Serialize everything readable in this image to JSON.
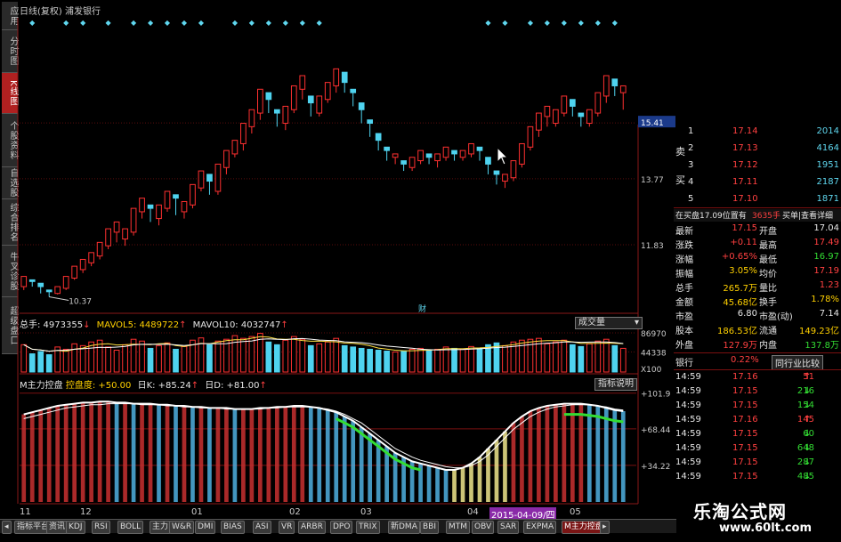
{
  "left_tabs": [
    {
      "label": "应用",
      "active": false
    },
    {
      "label": "分时图",
      "active": false
    },
    {
      "label": "K线图",
      "active": true
    },
    {
      "label": "个股资料",
      "active": false
    },
    {
      "label": "自选股",
      "active": false
    },
    {
      "label": "综合排名",
      "active": false
    },
    {
      "label": "牛叉诊股",
      "active": false
    },
    {
      "label": "超级盘口",
      "active": false
    }
  ],
  "main_chart": {
    "title": "日线(复权)  浦发银行",
    "y_ticks": [
      "15.41",
      "13.77",
      "11.83"
    ],
    "current_price_tag": "15.41",
    "low_label": "10.37",
    "finance_mark": "财"
  },
  "volume_panel": {
    "total_label": "总手: 4973355",
    "mavol5_label": "MAVOL5: 4489722",
    "mavol10_label": "MAVOL10: 4032747",
    "dropdown_label": "成交量",
    "y_ticks": [
      "86970",
      "44338",
      "X100"
    ]
  },
  "indicator_panel": {
    "name": "M主力控盘",
    "sub": "控盘度: +50.00",
    "k_label": "日K: +85.24",
    "d_label": "日D: +81.00",
    "help_button": "指标说明",
    "y_ticks": [
      "+101.9",
      "+68.44",
      "+34.22"
    ]
  },
  "x_axis": {
    "labels": [
      "11",
      "12",
      "01",
      "02",
      "03",
      "04",
      "05"
    ],
    "highlight_date": "2015-04-09/四"
  },
  "chart_data": {
    "type": "candlestick",
    "symbol": "浦发银行",
    "ylim": [
      10.0,
      18.5
    ],
    "candles": [
      [
        10.6,
        10.9,
        10.5,
        10.8
      ],
      [
        10.8,
        10.75,
        10.6,
        10.7
      ],
      [
        10.7,
        10.6,
        10.4,
        10.5
      ],
      [
        10.5,
        10.45,
        10.3,
        10.37
      ],
      [
        10.4,
        10.6,
        10.37,
        10.55
      ],
      [
        10.55,
        10.9,
        10.5,
        10.85
      ],
      [
        10.85,
        11.2,
        10.8,
        11.1
      ],
      [
        11.1,
        11.4,
        11.0,
        11.3
      ],
      [
        11.3,
        11.6,
        11.2,
        11.5
      ],
      [
        11.5,
        11.9,
        11.4,
        11.8
      ],
      [
        11.8,
        12.3,
        11.7,
        12.2
      ],
      [
        12.2,
        12.5,
        11.9,
        12.0
      ],
      [
        12.0,
        12.3,
        11.8,
        12.2
      ],
      [
        12.2,
        12.9,
        12.1,
        12.8
      ],
      [
        12.8,
        13.2,
        12.6,
        13.0
      ],
      [
        13.0,
        12.9,
        12.5,
        12.6
      ],
      [
        12.6,
        13.0,
        12.4,
        12.9
      ],
      [
        12.9,
        13.4,
        12.8,
        13.3
      ],
      [
        13.3,
        13.2,
        12.7,
        12.8
      ],
      [
        12.8,
        13.1,
        12.6,
        13.0
      ],
      [
        13.0,
        13.6,
        12.9,
        13.5
      ],
      [
        13.5,
        14.0,
        13.4,
        13.9
      ],
      [
        13.9,
        13.7,
        13.3,
        13.4
      ],
      [
        13.4,
        14.2,
        13.3,
        14.1
      ],
      [
        14.1,
        14.6,
        13.9,
        14.5
      ],
      [
        14.5,
        14.9,
        14.4,
        14.8
      ],
      [
        14.8,
        15.4,
        14.6,
        15.3
      ],
      [
        15.3,
        15.8,
        15.1,
        15.7
      ],
      [
        15.7,
        16.4,
        15.5,
        16.3
      ],
      [
        16.3,
        16.1,
        15.7,
        15.8
      ],
      [
        15.8,
        15.7,
        15.3,
        15.4
      ],
      [
        15.4,
        15.9,
        15.2,
        15.8
      ],
      [
        15.8,
        16.5,
        15.7,
        16.4
      ],
      [
        16.4,
        16.8,
        16.1,
        16.2
      ],
      [
        16.2,
        16.0,
        15.6,
        15.7
      ],
      [
        15.7,
        16.2,
        15.6,
        16.1
      ],
      [
        16.1,
        16.6,
        16.0,
        16.5
      ],
      [
        16.5,
        17.0,
        16.3,
        16.9
      ],
      [
        16.9,
        16.6,
        16.3,
        16.4
      ],
      [
        16.4,
        16.3,
        15.9,
        16.0
      ],
      [
        16.0,
        15.8,
        15.4,
        15.5
      ],
      [
        15.5,
        15.4,
        15.0,
        15.1
      ],
      [
        15.1,
        14.9,
        14.6,
        14.7
      ],
      [
        14.7,
        14.6,
        14.3,
        14.4
      ],
      [
        14.4,
        14.5,
        14.2,
        14.3
      ],
      [
        14.3,
        14.2,
        14.0,
        14.1
      ],
      [
        14.1,
        14.4,
        14.0,
        14.3
      ],
      [
        14.3,
        14.6,
        14.2,
        14.5
      ],
      [
        14.5,
        14.4,
        14.2,
        14.3
      ],
      [
        14.3,
        14.5,
        14.1,
        14.4
      ],
      [
        14.4,
        14.7,
        14.3,
        14.6
      ],
      [
        14.6,
        14.5,
        14.3,
        14.4
      ],
      [
        14.4,
        14.6,
        14.3,
        14.5
      ],
      [
        14.5,
        14.8,
        14.4,
        14.7
      ],
      [
        14.7,
        14.6,
        14.3,
        14.4
      ],
      [
        14.4,
        14.2,
        13.9,
        14.0
      ],
      [
        14.0,
        13.9,
        13.6,
        13.7
      ],
      [
        13.7,
        13.9,
        13.5,
        13.8
      ],
      [
        13.8,
        14.3,
        13.7,
        14.2
      ],
      [
        14.2,
        14.8,
        14.1,
        14.7
      ],
      [
        14.7,
        15.3,
        14.6,
        15.2
      ],
      [
        15.2,
        15.7,
        15.0,
        15.6
      ],
      [
        15.6,
        15.9,
        15.3,
        15.4
      ],
      [
        15.4,
        15.8,
        15.3,
        15.7
      ],
      [
        15.7,
        16.2,
        15.6,
        16.1
      ],
      [
        16.1,
        15.9,
        15.6,
        15.7
      ],
      [
        15.7,
        15.6,
        15.3,
        15.4
      ],
      [
        15.4,
        15.8,
        15.3,
        15.7
      ],
      [
        15.7,
        16.3,
        15.6,
        16.2
      ],
      [
        16.2,
        16.8,
        16.0,
        16.7
      ],
      [
        16.7,
        16.5,
        16.2,
        16.3
      ],
      [
        16.3,
        16.5,
        15.8,
        15.9
      ]
    ],
    "volume": [
      60,
      40,
      45,
      38,
      55,
      50,
      62,
      58,
      66,
      70,
      55,
      48,
      60,
      72,
      68,
      52,
      58,
      64,
      50,
      56,
      70,
      75,
      60,
      68,
      72,
      80,
      74,
      78,
      85,
      66,
      60,
      70,
      78,
      72,
      58,
      62,
      66,
      74,
      58,
      55,
      52,
      50,
      48,
      46,
      44,
      46,
      50,
      52,
      48,
      50,
      55,
      52,
      50,
      56,
      52,
      60,
      64,
      58,
      66,
      70,
      72,
      74,
      62,
      66,
      70,
      60,
      56,
      62,
      68,
      72,
      58,
      52
    ],
    "kd_k": [
      82,
      84,
      86,
      88,
      90,
      91,
      92,
      93,
      93,
      94,
      94,
      93,
      93,
      92,
      92,
      92,
      91,
      91,
      90,
      90,
      89,
      89,
      88,
      88,
      88,
      87,
      87,
      87,
      88,
      88,
      89,
      89,
      90,
      90,
      89,
      88,
      86,
      84,
      80,
      76,
      70,
      64,
      58,
      52,
      46,
      42,
      38,
      36,
      34,
      32,
      30,
      30,
      32,
      36,
      42,
      50,
      58,
      66,
      74,
      80,
      85,
      88,
      90,
      91,
      92,
      92,
      92,
      91,
      90,
      88,
      86,
      85
    ],
    "kd_d": [
      78,
      80,
      82,
      84,
      86,
      88,
      89,
      90,
      91,
      91,
      92,
      92,
      92,
      92,
      91,
      91,
      91,
      90,
      90,
      89,
      89,
      88,
      88,
      88,
      87,
      87,
      87,
      87,
      87,
      88,
      88,
      89,
      89,
      89,
      89,
      88,
      87,
      85,
      82,
      78,
      74,
      68,
      62,
      56,
      50,
      46,
      42,
      39,
      37,
      35,
      33,
      32,
      32,
      34,
      38,
      44,
      52,
      60,
      68,
      74,
      80,
      84,
      87,
      89,
      90,
      91,
      91,
      91,
      90,
      89,
      87,
      86
    ]
  },
  "order_book": {
    "sell_label": "卖盘",
    "buy_label": "买盘",
    "sell": [
      {
        "level": "1",
        "price": "17.14",
        "vol": "2014"
      },
      {
        "level": "2",
        "price": "17.13",
        "vol": "4164"
      },
      {
        "level": "3",
        "price": "17.12",
        "vol": "1951"
      },
      {
        "level": "4",
        "price": "17.11",
        "vol": "2187"
      },
      {
        "level": "5",
        "price": "17.10",
        "vol": "1871"
      }
    ],
    "bid_info": "在买盘17.09位置有",
    "bid_qty": "3635手",
    "bid_link": "买单|查看详细"
  },
  "quote": {
    "rows": [
      {
        "l1": "最新",
        "v1": "17.15",
        "c1": "red",
        "l2": "开盘",
        "v2": "17.04",
        "c2": "white"
      },
      {
        "l1": "涨跌",
        "v1": "+0.11",
        "c1": "red",
        "l2": "最高",
        "v2": "17.49",
        "c2": "red"
      },
      {
        "l1": "涨幅",
        "v1": "+0.65%",
        "c1": "red",
        "l2": "最低",
        "v2": "16.97",
        "c2": "green"
      },
      {
        "l1": "振幅",
        "v1": "3.05%",
        "c1": "yellow",
        "l2": "均价",
        "v2": "17.19",
        "c2": "red"
      },
      {
        "l1": "总手",
        "v1": "265.7万",
        "c1": "yellow",
        "l2": "量比",
        "v2": "1.23",
        "c2": "red"
      },
      {
        "l1": "金额",
        "v1": "45.68亿",
        "c1": "yellow",
        "l2": "换手",
        "v2": "1.78%",
        "c2": "yellow"
      },
      {
        "l1": "市盈",
        "v1": "6.80",
        "c1": "white",
        "l2": "市盈(动)",
        "v2": "7.14",
        "c2": "white"
      },
      {
        "l1": "股本",
        "v1": "186.53亿",
        "c1": "yellow",
        "l2": "流通",
        "v2": "149.23亿",
        "c2": "yellow"
      },
      {
        "l1": "外盘",
        "v1": "127.9万",
        "c1": "red",
        "l2": "内盘",
        "v2": "137.8万",
        "c2": "green"
      }
    ],
    "sector": "银行",
    "sector_change": "0.22%",
    "compare_button": "同行业比较"
  },
  "ticks": [
    {
      "time": "14:59",
      "price": "17.16",
      "vol": "51",
      "dir": "up"
    },
    {
      "time": "14:59",
      "price": "17.15",
      "vol": "216",
      "dir": "down"
    },
    {
      "time": "14:59",
      "price": "17.15",
      "vol": "154",
      "dir": "down"
    },
    {
      "time": "14:59",
      "price": "17.16",
      "vol": "145",
      "dir": "up"
    },
    {
      "time": "14:59",
      "price": "17.15",
      "vol": "60",
      "dir": "down"
    },
    {
      "time": "14:59",
      "price": "17.15",
      "vol": "648",
      "dir": "down"
    },
    {
      "time": "14:59",
      "price": "17.15",
      "vol": "287",
      "dir": "down"
    },
    {
      "time": "14:59",
      "price": "17.15",
      "vol": "485",
      "dir": "down"
    }
  ],
  "bottom_tabs": [
    "指标平台",
    "资讯",
    "KDJ",
    "RSI",
    "BOLL",
    "主力",
    "W&R",
    "DMI",
    "BIAS",
    "ASI",
    "VR",
    "ARBR",
    "DPO",
    "TRIX",
    "新DMA",
    "BBI",
    "MTM",
    "OBV",
    "SAR",
    "EXPMA",
    "M主力控盘"
  ],
  "watermark": {
    "line1": "乐淘公式网",
    "line2": "www.60lt.com"
  },
  "colors": {
    "up": "#ff3030",
    "down": "#4fd3ef",
    "bg": "#000000",
    "grid": "#7a1010"
  }
}
